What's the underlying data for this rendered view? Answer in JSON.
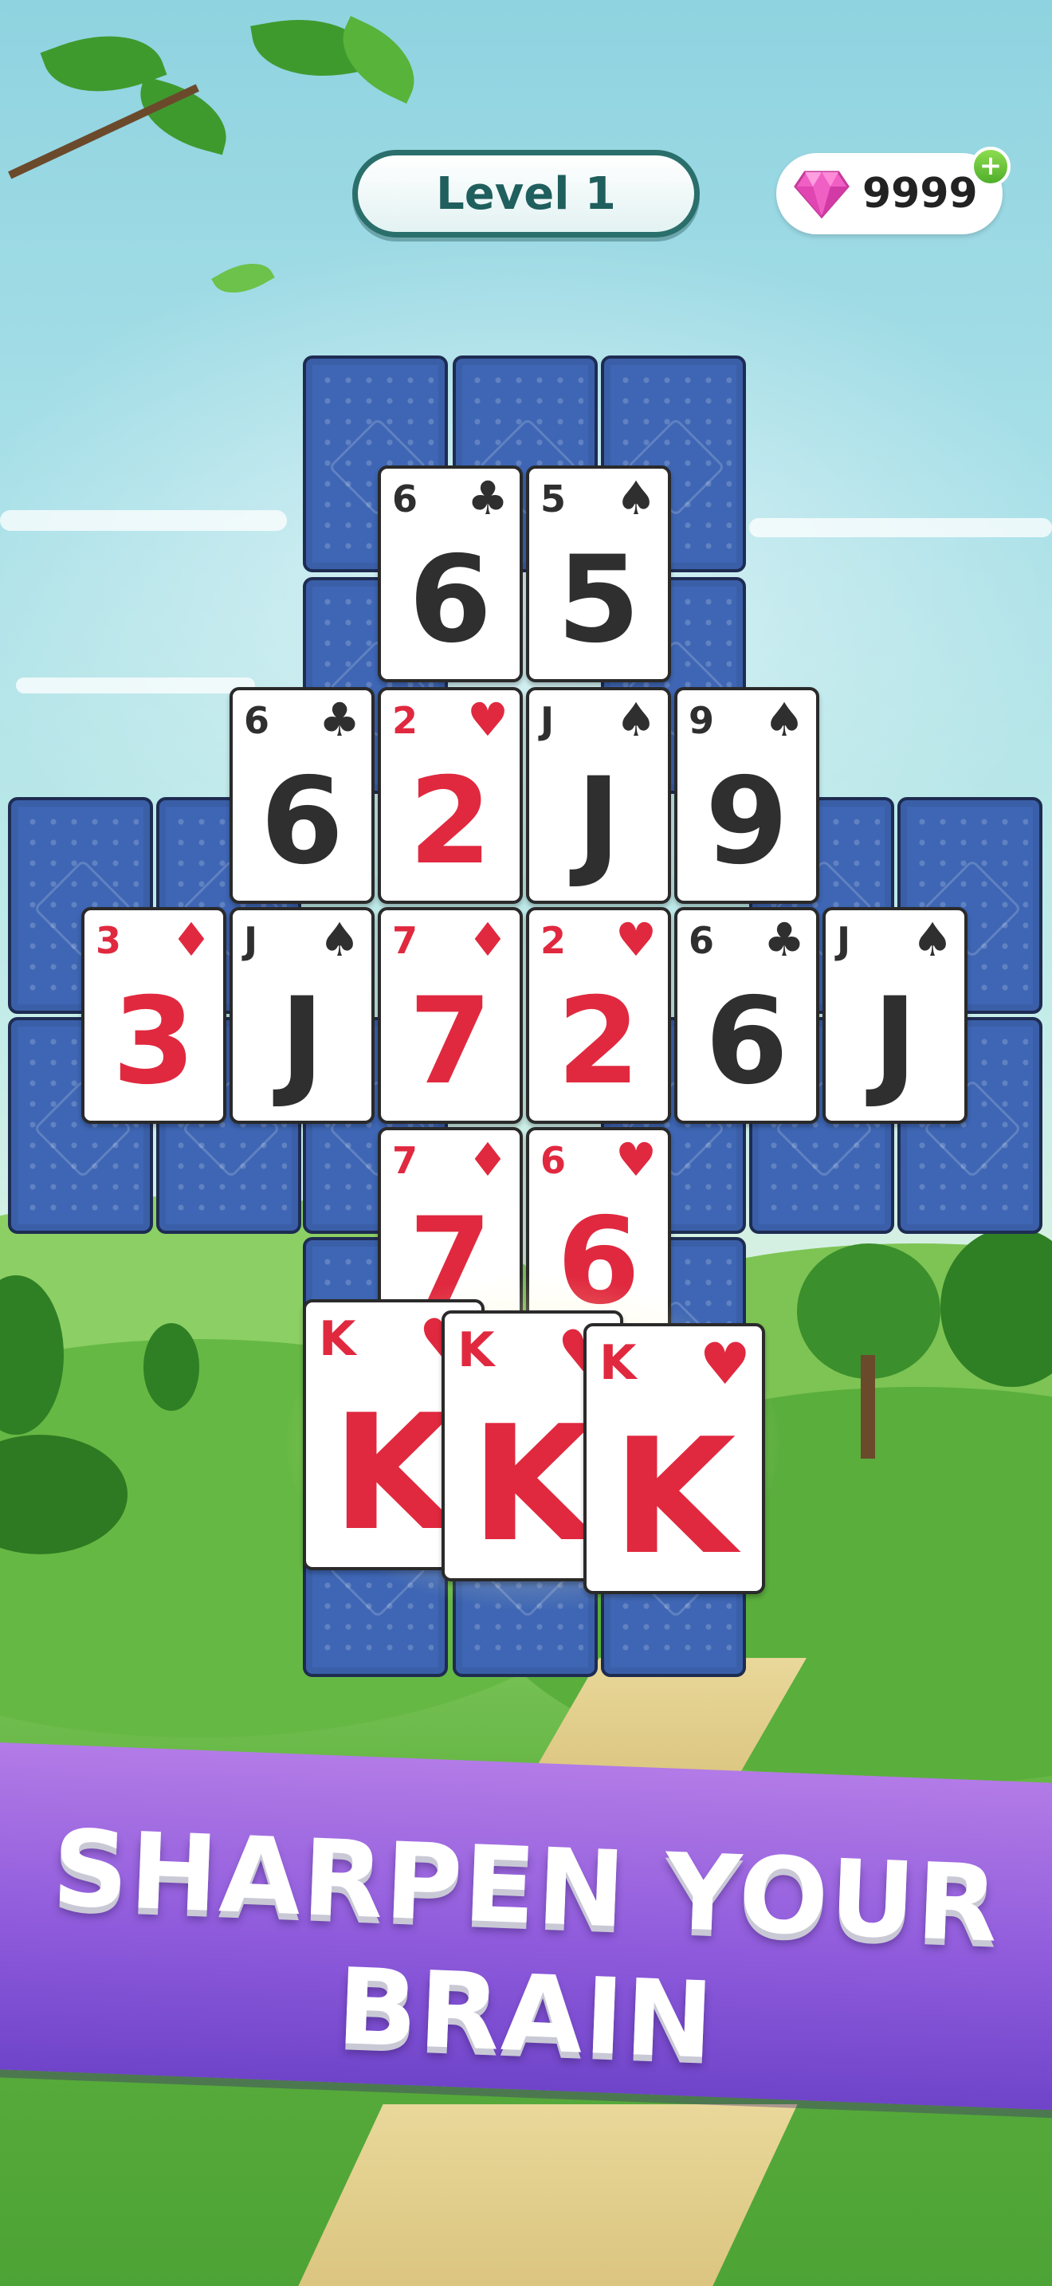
{
  "header": {
    "level_label": "Level 1",
    "gems_count": "9999",
    "gem_icon": "pink-diamond-icon",
    "add_icon": "plus-icon"
  },
  "board": {
    "face_cards": [
      {
        "id": "r1c1",
        "rank": "6",
        "suit": "♣",
        "color": "black"
      },
      {
        "id": "r1c2",
        "rank": "5",
        "suit": "♠",
        "color": "black"
      },
      {
        "id": "r2c1",
        "rank": "6",
        "suit": "♣",
        "color": "black"
      },
      {
        "id": "r2c2",
        "rank": "2",
        "suit": "♥",
        "color": "red"
      },
      {
        "id": "r2c3",
        "rank": "J",
        "suit": "♠",
        "color": "black"
      },
      {
        "id": "r2c4",
        "rank": "9",
        "suit": "♠",
        "color": "black"
      },
      {
        "id": "r3c1",
        "rank": "3",
        "suit": "♦",
        "color": "red"
      },
      {
        "id": "r3c2",
        "rank": "J",
        "suit": "♠",
        "color": "black"
      },
      {
        "id": "r3c3",
        "rank": "7",
        "suit": "♦",
        "color": "red"
      },
      {
        "id": "r3c4",
        "rank": "2",
        "suit": "♥",
        "color": "red"
      },
      {
        "id": "r3c5",
        "rank": "6",
        "suit": "♣",
        "color": "black"
      },
      {
        "id": "r3c6",
        "rank": "J",
        "suit": "♠",
        "color": "black"
      },
      {
        "id": "r4c1",
        "rank": "7",
        "suit": "♦",
        "color": "red"
      },
      {
        "id": "r4c2",
        "rank": "6",
        "suit": "♥",
        "color": "red"
      }
    ],
    "hand_cards": [
      {
        "id": "h1",
        "rank": "K",
        "suit": "♥",
        "color": "red"
      },
      {
        "id": "h2",
        "rank": "K",
        "suit": "♥",
        "color": "red"
      },
      {
        "id": "h3",
        "rank": "K",
        "suit": "♥",
        "color": "red"
      }
    ]
  },
  "banner": {
    "line1": "SHARPEN YOUR",
    "line2": "BRAIN"
  },
  "colors": {
    "card_red": "#e0293f",
    "card_black": "#2f2f2f",
    "card_back": "#3e66b4",
    "banner": "#8f5bdc",
    "level_border": "#2b6f6c"
  }
}
